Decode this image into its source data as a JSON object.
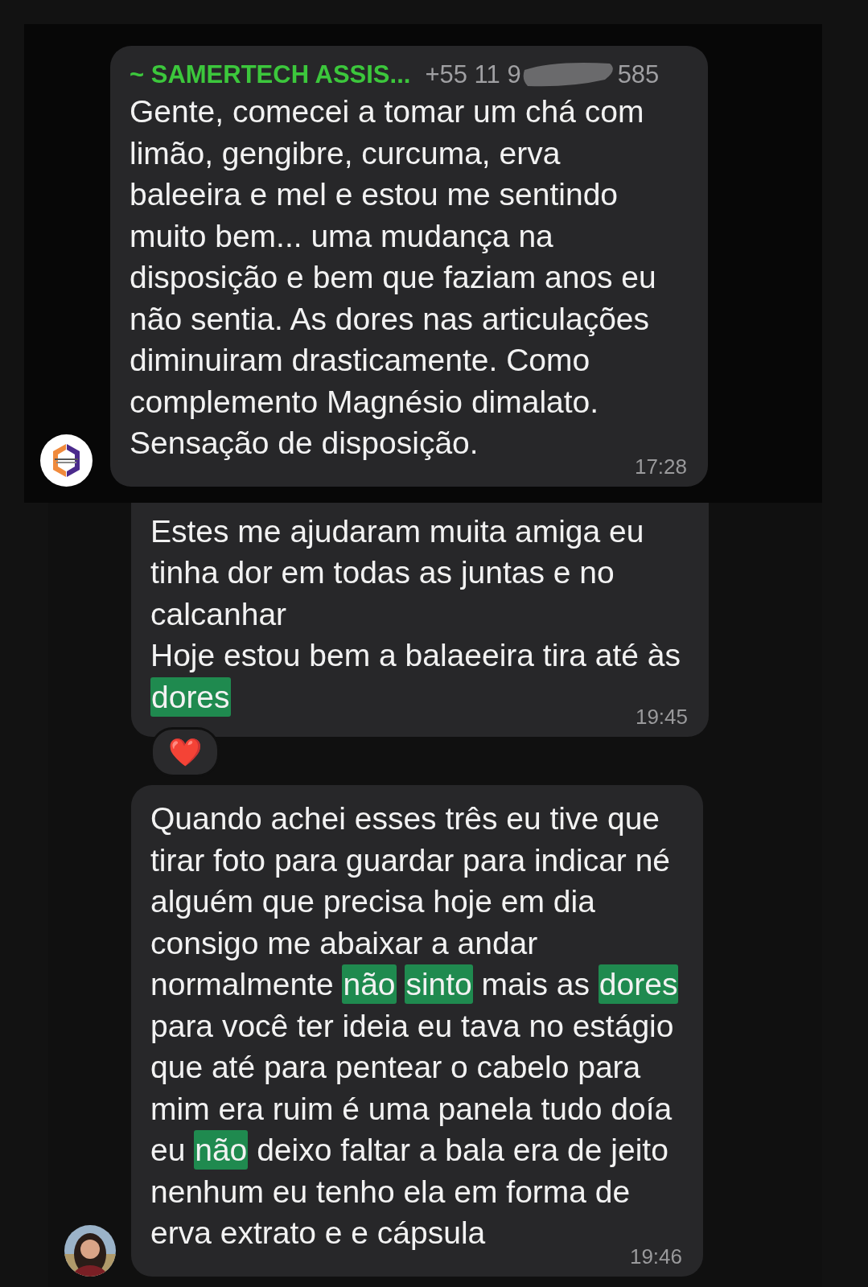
{
  "panels": [
    {
      "avatar": {
        "kind": "logo"
      },
      "messages": [
        {
          "sender": {
            "name": "~ SAMERTECH ASSIS...",
            "phone_start": "+55 11 9",
            "phone_end": "585",
            "redacted": true
          },
          "cut_top": false,
          "time": "17:28",
          "lines": [
            [
              {
                "text": "Gente, comecei a tomar um chá com",
                "highlighted": false
              }
            ],
            [
              {
                "text": "limão, gengibre, curcuma, erva",
                "highlighted": false
              }
            ],
            [
              {
                "text": "baleeira e mel e estou me sentindo",
                "highlighted": false
              }
            ],
            [
              {
                "text": "muito bem... uma mudança na",
                "highlighted": false
              }
            ],
            [
              {
                "text": "disposição e bem que faziam anos eu",
                "highlighted": false
              }
            ],
            [
              {
                "text": "não sentia. As dores nas articulações",
                "highlighted": false
              }
            ],
            [
              {
                "text": "diminuiram drasticamente. Como",
                "highlighted": false
              }
            ],
            [
              {
                "text": "complemento Magnésio dimalato.",
                "highlighted": false
              }
            ],
            [
              {
                "text": "Sensação de disposição.",
                "highlighted": false
              }
            ]
          ]
        }
      ]
    },
    {
      "avatar": {
        "kind": "person"
      },
      "messages": [
        {
          "cut_top": true,
          "time": "19:45",
          "reaction": "❤️",
          "lines": [
            [
              {
                "text": "Estes me ajudaram muita amiga eu",
                "highlighted": false
              }
            ],
            [
              {
                "text": "tinha dor em todas as juntas e no",
                "highlighted": false
              }
            ],
            [
              {
                "text": "calcanhar",
                "highlighted": false
              }
            ],
            [
              {
                "text": "Hoje estou bem a balaeeira tira até às",
                "highlighted": false
              }
            ],
            [
              {
                "text": "dores",
                "highlighted": true
              }
            ]
          ]
        },
        {
          "cut_top": false,
          "time": "19:46",
          "lines": [
            [
              {
                "text": "Quando achei esses três eu tive que",
                "highlighted": false
              }
            ],
            [
              {
                "text": "tirar foto para guardar para indicar né",
                "highlighted": false
              }
            ],
            [
              {
                "text": "alguém que precisa hoje em dia",
                "highlighted": false
              }
            ],
            [
              {
                "text": "consigo me abaixar a andar",
                "highlighted": false
              }
            ],
            [
              {
                "text": "normalmente",
                "highlighted": false
              },
              {
                "text": "não",
                "highlighted": true
              },
              {
                "text": "sinto",
                "highlighted": true
              },
              {
                "text": "mais as",
                "highlighted": false
              },
              {
                "text": "dores",
                "highlighted": true
              }
            ],
            [
              {
                "text": "para você ter ideia eu tava no estágio",
                "highlighted": false
              }
            ],
            [
              {
                "text": "que até para pentear o cabelo para",
                "highlighted": false
              }
            ],
            [
              {
                "text": "mim era ruim é uma panela tudo doía",
                "highlighted": false
              }
            ],
            [
              {
                "text": "eu",
                "highlighted": false
              },
              {
                "text": "não",
                "highlighted": true
              },
              {
                "text": "deixo faltar a bala era de jeito",
                "highlighted": false
              }
            ],
            [
              {
                "text": "nenhum eu tenho ela em forma de",
                "highlighted": false
              }
            ],
            [
              {
                "text": "erva extrato e e cápsula",
                "highlighted": false
              }
            ]
          ]
        }
      ]
    }
  ]
}
